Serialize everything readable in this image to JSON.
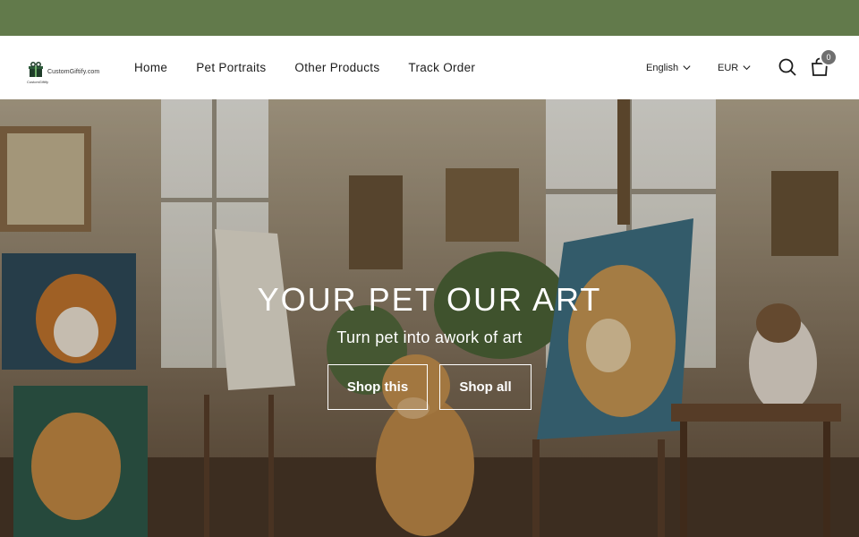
{
  "colors": {
    "announcement_bg": "#627a4b",
    "header_bg": "#ffffff",
    "cart_badge": "#6f6f6f",
    "hero_text": "#ffffff"
  },
  "header": {
    "logo_text": "CustomGiftify.com",
    "logo_sub": "CustomGiftify",
    "nav": [
      {
        "label": "Home"
      },
      {
        "label": "Pet Portraits"
      },
      {
        "label": "Other Products"
      },
      {
        "label": "Track Order"
      }
    ],
    "language": "English",
    "currency": "EUR",
    "cart_count": "0",
    "icons": [
      "gift-logo-icon",
      "chevron-down-icon",
      "search-icon",
      "cart-icon"
    ]
  },
  "hero": {
    "heading": "YOUR PET OUR ART",
    "subheading": "Turn pet into awork of art",
    "buttons": [
      {
        "label": "Shop this"
      },
      {
        "label": "Shop all"
      }
    ]
  }
}
